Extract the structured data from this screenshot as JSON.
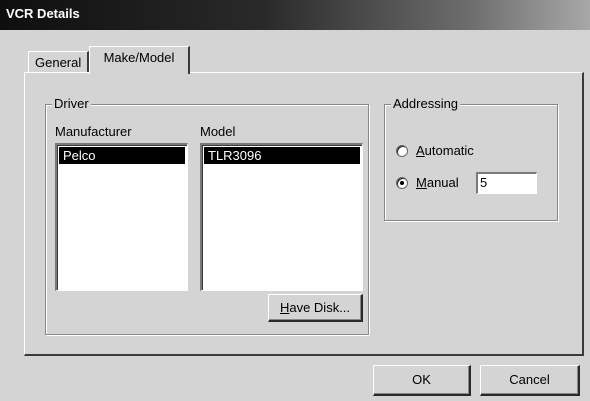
{
  "window": {
    "title": "VCR Details"
  },
  "tabs": [
    {
      "label": "General",
      "active": false
    },
    {
      "label": "Make/Model",
      "active": true
    }
  ],
  "driver": {
    "legend": "Driver",
    "manufacturer_label": "Manufacturer",
    "model_label": "Model",
    "manufacturers": [
      "Pelco"
    ],
    "models": [
      "TLR3096"
    ],
    "have_disk": {
      "accel": "H",
      "rest": "ave Disk..."
    }
  },
  "addressing": {
    "legend": "Addressing",
    "automatic": {
      "accel": "A",
      "rest": "utomatic",
      "selected": false
    },
    "manual": {
      "accel": "M",
      "rest": "anual",
      "selected": true
    },
    "manual_value": "5"
  },
  "footer": {
    "ok": "OK",
    "cancel": "Cancel"
  }
}
